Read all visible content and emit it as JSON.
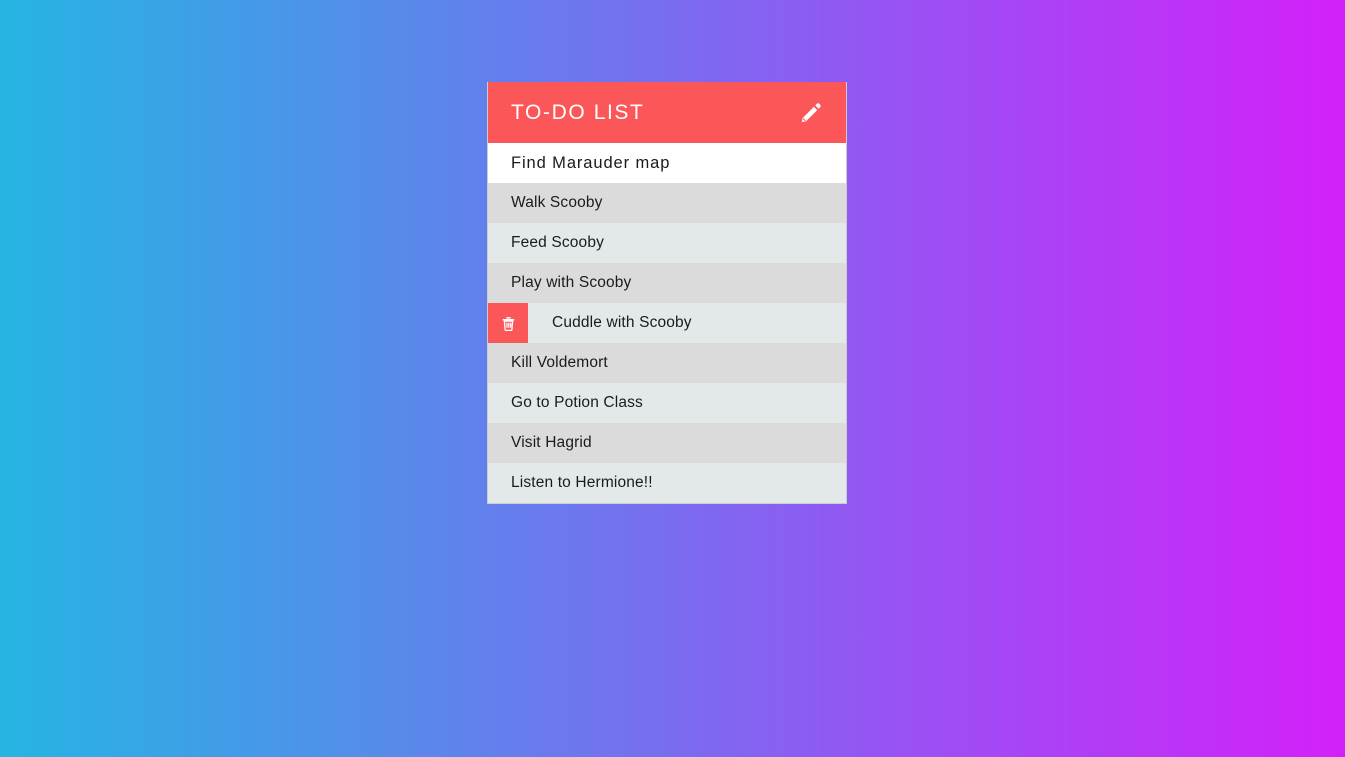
{
  "theme": {
    "bg_gradient_start": "#25b5e3",
    "bg_gradient_mid": "#7a6cf0",
    "bg_gradient_end": "#d320fa",
    "accent_red": "#fb5758",
    "row_odd": "#dbdbdb",
    "row_even": "#e2e9e8",
    "text_color": "#1b1b1b"
  },
  "header": {
    "title": "TO-DO LIST",
    "edit_icon": "pencil-icon"
  },
  "new_task": {
    "value": "Find Marauder map",
    "placeholder": "Find Marauder map"
  },
  "tasks": [
    {
      "label": "Walk Scooby",
      "shade": "odd",
      "show_delete": false
    },
    {
      "label": "Feed Scooby",
      "shade": "even",
      "show_delete": false
    },
    {
      "label": "Play with Scooby",
      "shade": "odd",
      "show_delete": false
    },
    {
      "label": "Cuddle with Scooby",
      "shade": "even",
      "show_delete": true
    },
    {
      "label": "Kill Voldemort",
      "shade": "odd",
      "show_delete": false
    },
    {
      "label": "Go to Potion Class",
      "shade": "even",
      "show_delete": false
    },
    {
      "label": "Visit Hagrid",
      "shade": "odd",
      "show_delete": false
    },
    {
      "label": "Listen to Hermione!!",
      "shade": "even",
      "show_delete": false
    }
  ],
  "icons": {
    "delete_icon": "trash-icon"
  }
}
